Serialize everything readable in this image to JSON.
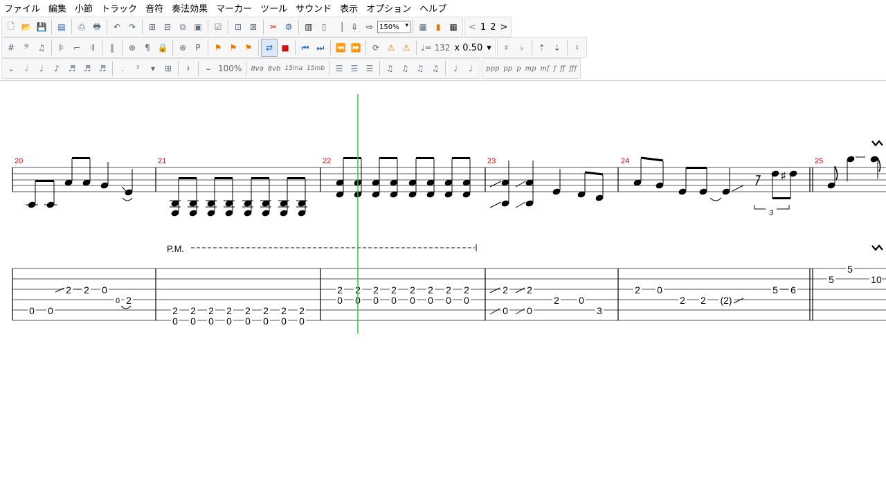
{
  "menu": {
    "items": [
      "ファイル",
      "編集",
      "小節",
      "トラック",
      "音符",
      "奏法効果",
      "マーカー",
      "ツール",
      "サウンド",
      "表示",
      "オプション",
      "ヘルプ"
    ]
  },
  "toolbar": {
    "zoom": "150%",
    "page_prev": "<",
    "page_1": "1",
    "page_2": "2",
    "page_next": ">",
    "tempo": "♩= 132",
    "speed": "x 0.50",
    "dynamics": [
      "ppp",
      "pp",
      "p",
      "mp",
      "mf",
      "f",
      "ff",
      "fff"
    ],
    "percent": "100%",
    "ottava": [
      "8va",
      "8vb",
      "15ma",
      "15mb"
    ]
  },
  "score": {
    "measures": [
      "20",
      "21",
      "22",
      "23",
      "24",
      "25"
    ],
    "palm_mute": "P.M.",
    "tuplet": "3",
    "tab_20": [
      "0",
      "0",
      "2",
      "2",
      "0",
      "0",
      "2"
    ],
    "tab_21_top": "2",
    "tab_21_bottom": "0",
    "tab_22_top": "2",
    "tab_22_bottom": "0",
    "tab_23": [
      "2",
      "0",
      "2",
      "0",
      "2",
      "0",
      "3"
    ],
    "tab_24": [
      "2",
      "0",
      "2",
      "2",
      "(2)",
      "5",
      "6"
    ],
    "tab_25": [
      "5",
      "5",
      "10"
    ]
  },
  "colors": {
    "measure_number": "#cc0000",
    "playback_cursor": "#2ecc40"
  }
}
